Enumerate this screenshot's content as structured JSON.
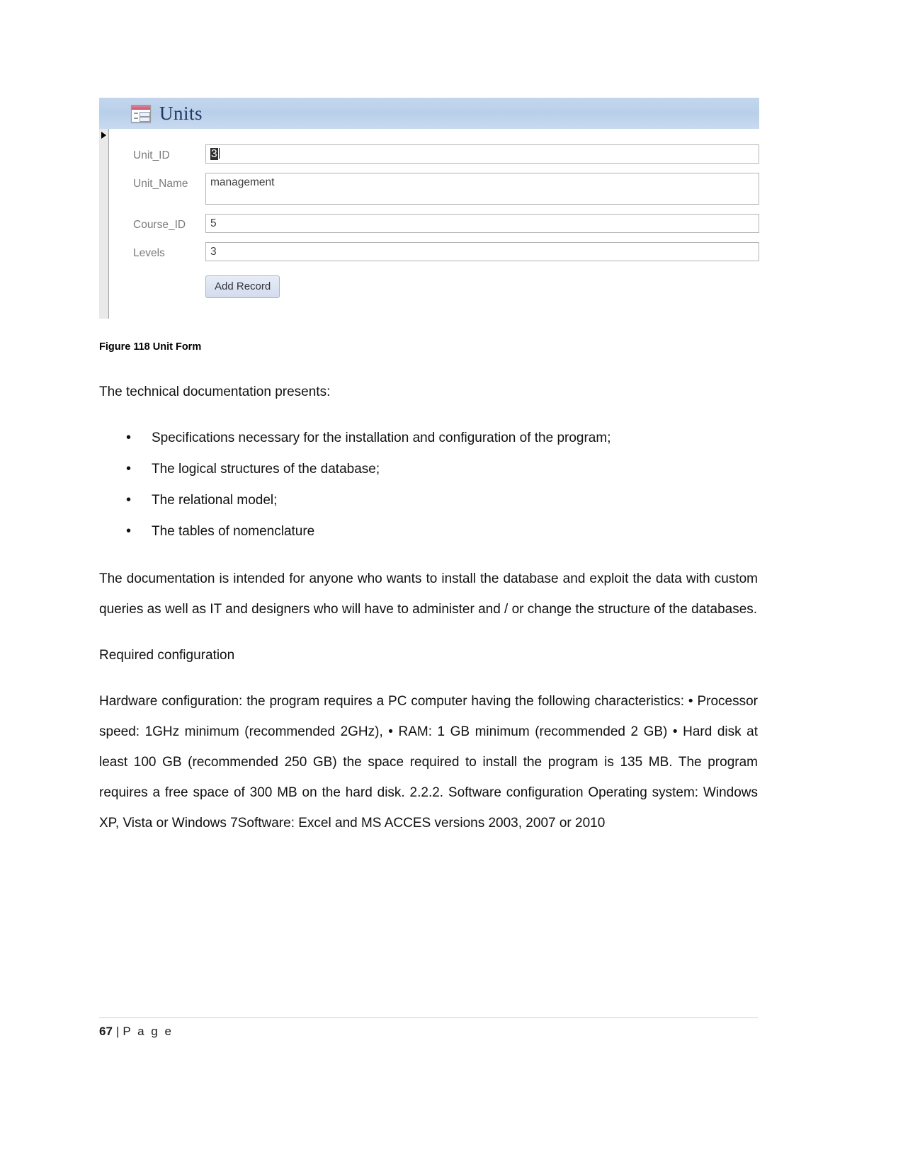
{
  "figure": {
    "form": {
      "title": "Units",
      "icon": "access-form-icon",
      "fields": [
        {
          "label": "Unit_ID",
          "value": "3",
          "selected": true
        },
        {
          "label": "Unit_Name",
          "value": "management",
          "selected": false
        },
        {
          "label": "Course_ID",
          "value": "5",
          "selected": false
        },
        {
          "label": "Levels",
          "value": "3",
          "selected": false
        }
      ],
      "button_label": "Add Record",
      "header_color": "#bfd3ec",
      "title_color": "#1f3864"
    },
    "caption": "Figure 118 Unit Form"
  },
  "content": {
    "intro": "The technical documentation presents:",
    "bullets": [
      "Specifications necessary for the installation and configuration of the program;",
      "The logical structures of the database;",
      "The relational model;",
      "The tables of nomenclature"
    ],
    "paragraph_audience": "The documentation is intended for anyone who wants to install the database and exploit the data with custom queries as well as IT and designers who will have to administer and / or change the structure of the databases.",
    "heading_required": "Required configuration",
    "paragraph_hardware": "Hardware configuration: the program requires a PC computer having the following characteristics: • Processor speed: 1GHz minimum (recommended 2GHz), • RAM: 1 GB minimum (recommended 2 GB) • Hard disk at least 100 GB (recommended 250 GB) the space required to install the program is 135 MB. The program requires a free space of 300 MB on the hard disk. 2.2.2. Software configuration Operating system: Windows XP, Vista or Windows 7Software: Excel and MS ACCES versions 2003, 2007 or 2010"
  },
  "footer": {
    "page_number": "67",
    "separator": "|",
    "page_word": "P a g e"
  }
}
